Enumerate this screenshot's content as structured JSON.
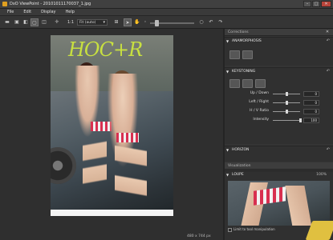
{
  "window": {
    "title": "DxO ViewPoint - 20101011170037_1.jpg",
    "buttons": {
      "minimize": "–",
      "maximize": "□",
      "close": "✕"
    }
  },
  "menu": [
    "File",
    "Edit",
    "Display",
    "Help"
  ],
  "toolbar": {
    "zoom_label": "1:1",
    "fit_select": "Fit (auto)"
  },
  "image": {
    "graffiti_text": "HOC+R",
    "dimensions": "480 x 744 px"
  },
  "panel": {
    "header": "Corrections",
    "anamorphosis": {
      "title": "ANAMORPHOSIS",
      "reset": "↶"
    },
    "keystoning": {
      "title": "KEYSTONING",
      "reset": "↶",
      "sliders": [
        {
          "label": "Up / Down",
          "value": "0",
          "level": 0.5
        },
        {
          "label": "Left / Right",
          "value": "0",
          "level": 0.5
        },
        {
          "label": "H / V Ratio",
          "value": "0",
          "level": 0.5
        },
        {
          "label": "Intensity",
          "value": "100",
          "level": 1.0
        }
      ]
    },
    "horizon": {
      "title": "HORIZON",
      "reset": "↶"
    },
    "visualization_header": "Visualization",
    "loupe": {
      "title": "LOUPE",
      "zoom": "100%",
      "limit_label": "Limit to tool manipulation"
    }
  },
  "colors": {
    "background": "#2b2b2b",
    "panel": "#343434",
    "skirt_red": "#d83050",
    "graffiti": "#c8e040"
  }
}
